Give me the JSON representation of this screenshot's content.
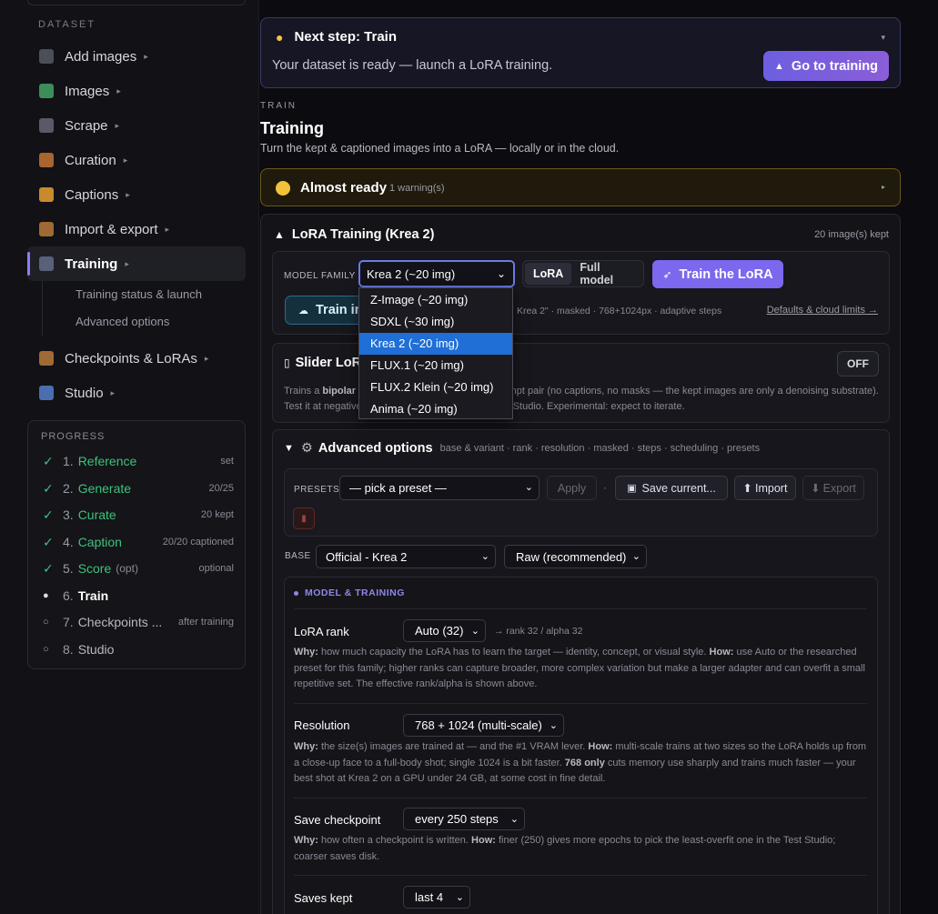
{
  "sidebar": {
    "section_label": "DATASET",
    "items": [
      {
        "label": "Add images",
        "icon": "camera-icon"
      },
      {
        "label": "Images",
        "icon": "image-icon"
      },
      {
        "label": "Scrape",
        "icon": "web-icon"
      },
      {
        "label": "Curation",
        "icon": "broom-icon"
      },
      {
        "label": "Captions",
        "icon": "writing-hand-icon"
      },
      {
        "label": "Import & export",
        "icon": "package-icon"
      },
      {
        "label": "Training",
        "icon": "graduation-cap-icon"
      },
      {
        "label": "Checkpoints & LoRAs",
        "icon": "package-icon"
      },
      {
        "label": "Studio",
        "icon": "control-knobs-icon"
      }
    ],
    "chevron": "▸",
    "training_sub": [
      "Training status & launch",
      "Advanced options"
    ]
  },
  "progress": {
    "title": "PROGRESS",
    "steps": [
      {
        "num": "1.",
        "label": "Reference",
        "meta": "set",
        "mark": "✓"
      },
      {
        "num": "2.",
        "label": "Generate",
        "meta": "20/25",
        "mark": "✓"
      },
      {
        "num": "3.",
        "label": "Curate",
        "meta": "20 kept",
        "mark": "✓"
      },
      {
        "num": "4.",
        "label": "Caption",
        "meta": "20/20 captioned",
        "mark": "✓"
      },
      {
        "num": "5.",
        "label": "Score",
        "opt": "(opt)",
        "meta": "optional",
        "mark": "✓"
      },
      {
        "num": "6.",
        "label": "Train",
        "meta": "",
        "mark": "●"
      },
      {
        "num": "7.",
        "label": "Checkpoints ...",
        "meta": "after training",
        "mark": "○"
      },
      {
        "num": "8.",
        "label": "Studio",
        "meta": "",
        "mark": "○"
      }
    ]
  },
  "next_step": {
    "title": "Next step: Train",
    "subtitle": "Your dataset is ready — launch a LoRA training.",
    "button": "Go to training",
    "caret": "▾"
  },
  "train": {
    "section_tag": "TRAIN",
    "title": "Training",
    "subtitle": "Turn the kept & captioned images into a LoRA — locally or in the cloud."
  },
  "warning": {
    "title": "Almost ready",
    "count": "1 warning(s)",
    "caret": "▸"
  },
  "lora": {
    "title": "LoRA Training (Krea 2)",
    "kept": "20 image(s) kept",
    "model_family_label": "MODEL FAMILY",
    "model_family_value": "Krea 2 (~20 img)",
    "seg_lora": "LoRA",
    "seg_full": "Full model",
    "train_button": "Train the LoRA",
    "cloud_button": "Train in the cloud",
    "meta": "Krea 2\" · masked · 768+1024px · adaptive steps",
    "defaults_link": "Defaults & cloud limits →"
  },
  "model_options": [
    "Z-Image (~20 img)",
    "SDXL (~30 img)",
    "Krea 2 (~20 img)",
    "FLUX.1 (~20 img)",
    "FLUX.2 Klein (~20 img)",
    "Anima (~20 img)"
  ],
  "slider": {
    "title": "Slider LoRA",
    "toggle": "OFF",
    "desc_a": "Trains a ",
    "desc_b": "bipolar",
    "desc_c": " slider from a positive/negative prompt pair (no captions, no masks — the kept images are only a denoising substrate).",
    "desc_d": "Test it at negative and positive strengths in the Test Studio. Experimental: expect to iterate."
  },
  "advanced": {
    "title": "Advanced options",
    "summary": "base & variant · rank · resolution · masked · steps · scheduling · presets",
    "presets_label": "PRESETS",
    "preset_value": "— pick a preset —",
    "apply": "Apply",
    "sep": "·",
    "save_current": "Save current...",
    "import": "Import",
    "export": "Export",
    "base_label": "BASE",
    "base_value": "Official - Krea 2",
    "variant_value": "Raw (recommended)"
  },
  "model_training": {
    "title": "MODEL & TRAINING",
    "rank_label": "LoRA rank",
    "rank_value": "Auto (32)",
    "rank_aside": "→ rank 32 / alpha 32",
    "why": "Why:",
    "how": "How:",
    "rank_why": " how much capacity the LoRA has to learn the target — identity, concept, or visual style. ",
    "rank_how": " use Auto or the researched preset for this family; higher ranks can capture broader, more complex variation but make a larger adapter and can overfit a small repetitive set. The effective rank/alpha is shown above.",
    "res_label": "Resolution",
    "res_value": "768 + 1024 (multi-scale)",
    "res_why": " the size(s) images are trained at — and the #1 VRAM lever. ",
    "res_how": " multi-scale trains at two sizes so the LoRA holds up from a close-up face to a full-body shot; single 1024 is a bit faster. ",
    "res_b": "768 only",
    "res_tail": " cuts memory use sharply and trains much faster — your best shot at Krea 2 on a GPU under 24 GB, at some cost in fine detail.",
    "save_label": "Save checkpoint",
    "save_value": "every 250 steps",
    "save_why": " how often a checkpoint is written. ",
    "save_how": " finer (250) gives more epochs to pick the least-overfit one in the Test Studio; coarser saves disk.",
    "kept_label": "Saves kept",
    "kept_value": "last 4"
  }
}
